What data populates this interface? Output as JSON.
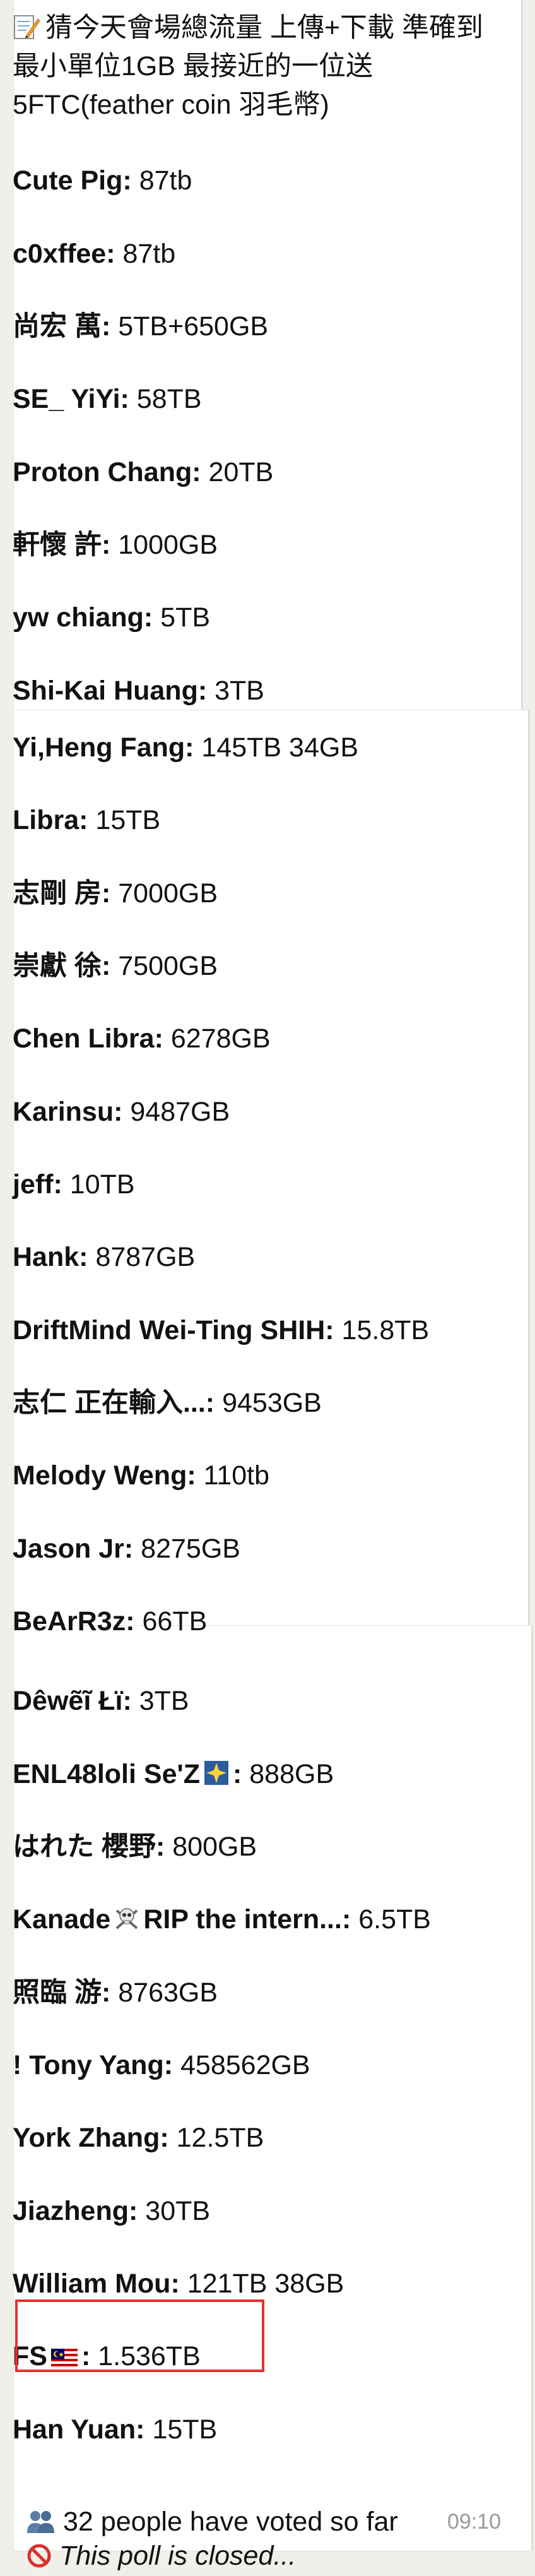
{
  "poll": {
    "title": "猜今天會場總流量 上傳+下載 準確到最小單位1GB 最接近的一位送5FTC(feather coin 羽毛幣)",
    "title_icon": "memo-icon",
    "entries": [
      {
        "name": "Cute Pig",
        "value": "87tb"
      },
      {
        "name": "c0xffee",
        "value": "87tb"
      },
      {
        "name": "尚宏 萬",
        "value": "5TB+650GB"
      },
      {
        "name": "SE_ YiYi",
        "value": "58TB"
      },
      {
        "name": "Proton Chang",
        "value": "20TB"
      },
      {
        "name": "軒懷 許",
        "value": "1000GB"
      },
      {
        "name": "yw chiang",
        "value": "5TB"
      },
      {
        "name": "Shi-Kai Huang",
        "value": "3TB"
      },
      {
        "name": "Yi,Heng Fang",
        "value": "145TB 34GB"
      },
      {
        "name": "Libra",
        "value": "15TB"
      },
      {
        "name": "志剛 房",
        "value": "7000GB"
      },
      {
        "name": "崇獻 徐",
        "value": "7500GB"
      },
      {
        "name": "Chen Libra",
        "value": "6278GB"
      },
      {
        "name": "Karinsu",
        "value": "9487GB"
      },
      {
        "name": "jeff",
        "value": "10TB"
      },
      {
        "name": "Hank",
        "value": "8787GB"
      },
      {
        "name": "DriftMind Wei-Ting SHIH",
        "value": "15.8TB"
      },
      {
        "name": "志仁 正在輸入...",
        "value": "9453GB"
      },
      {
        "name": "Melody Weng",
        "value": "110tb"
      },
      {
        "name": "Jason Jr",
        "value": "8275GB"
      },
      {
        "name": "BeArR3z",
        "value": "66TB"
      },
      {
        "name": "Dêwẽĩ Łï",
        "value": "3TB"
      },
      {
        "name": "ENL48loli Se'Z",
        "value": "888GB"
      },
      {
        "name": "はれた 櫻野",
        "value": "800GB"
      },
      {
        "name": "Kanade",
        "name_suffix": "RIP the intern...",
        "value": "6.5TB"
      },
      {
        "name": "照臨 游",
        "value": "8763GB"
      },
      {
        "name": "! Tony Yang",
        "value": "458562GB"
      },
      {
        "name": "York Zhang",
        "value": "12.5TB"
      },
      {
        "name": "Jiazheng",
        "value": "30TB"
      },
      {
        "name": "William Mou",
        "value": "121TB 38GB"
      },
      {
        "name": "FS",
        "value": "1.536TB"
      },
      {
        "name": "Han Yuan",
        "value": "15TB"
      }
    ],
    "vote_count_text": "32 people have voted so far",
    "vote_icon": "people-icon",
    "closed_text": "This poll is closed...",
    "closed_icon": "prohibited-icon",
    "timestamp": "09:10",
    "highlight_color": "#e2322e"
  }
}
